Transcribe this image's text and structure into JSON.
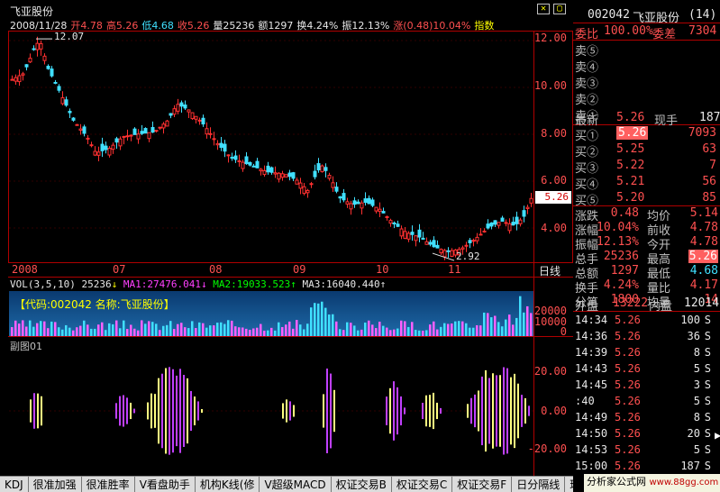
{
  "stock": {
    "title": "飞亚股份",
    "date": "2008/11/28",
    "open": "开4.78",
    "high": "高5.26",
    "low": "低4.68",
    "close": "收5.26",
    "vol": "量25236",
    "amt": "额1297",
    "turn": "换4.24%",
    "amp": "振12.13%",
    "chg": "涨(0.48)10.04%",
    "index": "指数"
  },
  "yaxis": [
    "12.00",
    "10.00",
    "8.00",
    "6.00",
    "4.00"
  ],
  "price_tag": "5.26",
  "high_marker": "12.07",
  "low_marker": "2.92",
  "xaxis": [
    "2008",
    "07",
    "08",
    "09",
    "10",
    "11",
    "日线"
  ],
  "vol_legend": {
    "name": "VOL(3,5,10)",
    "value": "25236",
    "ma1": "MA1:27476.041",
    "ma2": "MA2:19033.523",
    "ma3": "MA3:16040.440"
  },
  "vol_banner": "【代码:002042 名称:飞亚股份】",
  "vol_axis": [
    "20000",
    "10000",
    "0"
  ],
  "sub_title": "副图01",
  "sub_axis": [
    "20.00",
    "0.00",
    "-20.00"
  ],
  "tabs": [
    "KDJ",
    "很准加强",
    "很准胜率",
    "V看盘助手",
    "机构K线(修",
    "V超级MACD",
    "权证交易B",
    "权证交易C",
    "权证交易F",
    "日分隔线",
    "理出"
  ],
  "panel": {
    "code": "002042",
    "name": "飞亚股份",
    "count": "(14)",
    "weibi_label": "委比",
    "weibi": "100.00%",
    "weicha_label": "委差",
    "weicha": "7304",
    "asks": [
      "卖⑤",
      "卖④",
      "卖③",
      "卖②",
      "卖①"
    ],
    "last_label": "最新",
    "last": "5.26",
    "cur_label": "现手",
    "cur": "187",
    "bids": [
      {
        "l": "买①",
        "p": "5.26",
        "v": "7093"
      },
      {
        "l": "买②",
        "p": "5.25",
        "v": "63"
      },
      {
        "l": "买③",
        "p": "5.22",
        "v": "7"
      },
      {
        "l": "买④",
        "p": "5.21",
        "v": "56"
      },
      {
        "l": "买⑤",
        "p": "5.20",
        "v": "85"
      }
    ],
    "stats": [
      {
        "a": "涨跌",
        "b": "0.48",
        "c": "均价",
        "d": "5.14"
      },
      {
        "a": "涨幅",
        "b": "10.04%",
        "c": "前收",
        "d": "4.78"
      },
      {
        "a": "振幅",
        "b": "12.13%",
        "c": "今开",
        "d": "4.78"
      },
      {
        "a": "总手",
        "b": "25236",
        "c": "最高",
        "d": "5.26"
      },
      {
        "a": "总额",
        "b": "1297",
        "c": "最低",
        "d": "4.68"
      },
      {
        "a": "换手",
        "b": "4.24%",
        "c": "量比",
        "d": "4.17"
      },
      {
        "a": "分笔",
        "b": "1800",
        "c": "均量",
        "d": "14"
      }
    ],
    "outer_label": "外盘",
    "outer": "13222",
    "inner_label": "内盘",
    "inner": "12014",
    "ticks": [
      {
        "t": "14:34",
        "p": "5.26",
        "v": "100",
        "s": "S"
      },
      {
        "t": "14:36",
        "p": "5.26",
        "v": "36",
        "s": "S"
      },
      {
        "t": "14:39",
        "p": "5.26",
        "v": "8",
        "s": "S"
      },
      {
        "t": "14:43",
        "p": "5.26",
        "v": "5",
        "s": "S"
      },
      {
        "t": "14:45",
        "p": "5.26",
        "v": "3",
        "s": "S"
      },
      {
        "t": ":40",
        "p": "5.26",
        "v": "5",
        "s": "S"
      },
      {
        "t": "14:49",
        "p": "5.26",
        "v": "8",
        "s": "S"
      },
      {
        "t": "14:50",
        "p": "5.26",
        "v": "20",
        "s": "S"
      },
      {
        "t": "14:53",
        "p": "5.26",
        "v": "5",
        "s": "S"
      },
      {
        "t": "15:00",
        "p": "5.26",
        "v": "187",
        "s": "S"
      }
    ]
  },
  "watermark": "分析家公式网",
  "watermark2": "www.88gg.com"
}
